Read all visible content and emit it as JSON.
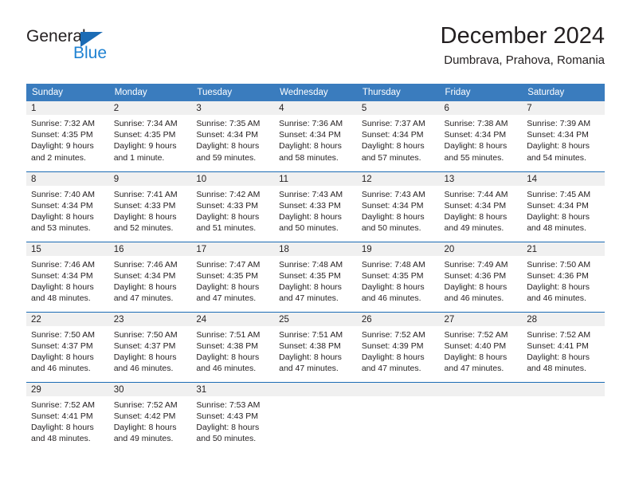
{
  "brand": {
    "name_top": "General",
    "name_bottom": "Blue",
    "accent_blue": "#1f82d2",
    "triangle_blue": "#1c6cb5"
  },
  "header": {
    "title": "December 2024",
    "subtitle": "Dumbrava, Prahova, Romania"
  },
  "calendar": {
    "header_bg": "#3a7cbe",
    "daynum_bg": "#f0f0f0",
    "row_divider": "#1c6cb5",
    "weekday_headers": [
      "Sunday",
      "Monday",
      "Tuesday",
      "Wednesday",
      "Thursday",
      "Friday",
      "Saturday"
    ],
    "weeks": [
      [
        {
          "day": "1",
          "sunrise": "Sunrise: 7:32 AM",
          "sunset": "Sunset: 4:35 PM",
          "daylight_1": "Daylight: 9 hours",
          "daylight_2": "and 2 minutes."
        },
        {
          "day": "2",
          "sunrise": "Sunrise: 7:34 AM",
          "sunset": "Sunset: 4:35 PM",
          "daylight_1": "Daylight: 9 hours",
          "daylight_2": "and 1 minute."
        },
        {
          "day": "3",
          "sunrise": "Sunrise: 7:35 AM",
          "sunset": "Sunset: 4:34 PM",
          "daylight_1": "Daylight: 8 hours",
          "daylight_2": "and 59 minutes."
        },
        {
          "day": "4",
          "sunrise": "Sunrise: 7:36 AM",
          "sunset": "Sunset: 4:34 PM",
          "daylight_1": "Daylight: 8 hours",
          "daylight_2": "and 58 minutes."
        },
        {
          "day": "5",
          "sunrise": "Sunrise: 7:37 AM",
          "sunset": "Sunset: 4:34 PM",
          "daylight_1": "Daylight: 8 hours",
          "daylight_2": "and 57 minutes."
        },
        {
          "day": "6",
          "sunrise": "Sunrise: 7:38 AM",
          "sunset": "Sunset: 4:34 PM",
          "daylight_1": "Daylight: 8 hours",
          "daylight_2": "and 55 minutes."
        },
        {
          "day": "7",
          "sunrise": "Sunrise: 7:39 AM",
          "sunset": "Sunset: 4:34 PM",
          "daylight_1": "Daylight: 8 hours",
          "daylight_2": "and 54 minutes."
        }
      ],
      [
        {
          "day": "8",
          "sunrise": "Sunrise: 7:40 AM",
          "sunset": "Sunset: 4:34 PM",
          "daylight_1": "Daylight: 8 hours",
          "daylight_2": "and 53 minutes."
        },
        {
          "day": "9",
          "sunrise": "Sunrise: 7:41 AM",
          "sunset": "Sunset: 4:33 PM",
          "daylight_1": "Daylight: 8 hours",
          "daylight_2": "and 52 minutes."
        },
        {
          "day": "10",
          "sunrise": "Sunrise: 7:42 AM",
          "sunset": "Sunset: 4:33 PM",
          "daylight_1": "Daylight: 8 hours",
          "daylight_2": "and 51 minutes."
        },
        {
          "day": "11",
          "sunrise": "Sunrise: 7:43 AM",
          "sunset": "Sunset: 4:33 PM",
          "daylight_1": "Daylight: 8 hours",
          "daylight_2": "and 50 minutes."
        },
        {
          "day": "12",
          "sunrise": "Sunrise: 7:43 AM",
          "sunset": "Sunset: 4:34 PM",
          "daylight_1": "Daylight: 8 hours",
          "daylight_2": "and 50 minutes."
        },
        {
          "day": "13",
          "sunrise": "Sunrise: 7:44 AM",
          "sunset": "Sunset: 4:34 PM",
          "daylight_1": "Daylight: 8 hours",
          "daylight_2": "and 49 minutes."
        },
        {
          "day": "14",
          "sunrise": "Sunrise: 7:45 AM",
          "sunset": "Sunset: 4:34 PM",
          "daylight_1": "Daylight: 8 hours",
          "daylight_2": "and 48 minutes."
        }
      ],
      [
        {
          "day": "15",
          "sunrise": "Sunrise: 7:46 AM",
          "sunset": "Sunset: 4:34 PM",
          "daylight_1": "Daylight: 8 hours",
          "daylight_2": "and 48 minutes."
        },
        {
          "day": "16",
          "sunrise": "Sunrise: 7:46 AM",
          "sunset": "Sunset: 4:34 PM",
          "daylight_1": "Daylight: 8 hours",
          "daylight_2": "and 47 minutes."
        },
        {
          "day": "17",
          "sunrise": "Sunrise: 7:47 AM",
          "sunset": "Sunset: 4:35 PM",
          "daylight_1": "Daylight: 8 hours",
          "daylight_2": "and 47 minutes."
        },
        {
          "day": "18",
          "sunrise": "Sunrise: 7:48 AM",
          "sunset": "Sunset: 4:35 PM",
          "daylight_1": "Daylight: 8 hours",
          "daylight_2": "and 47 minutes."
        },
        {
          "day": "19",
          "sunrise": "Sunrise: 7:48 AM",
          "sunset": "Sunset: 4:35 PM",
          "daylight_1": "Daylight: 8 hours",
          "daylight_2": "and 46 minutes."
        },
        {
          "day": "20",
          "sunrise": "Sunrise: 7:49 AM",
          "sunset": "Sunset: 4:36 PM",
          "daylight_1": "Daylight: 8 hours",
          "daylight_2": "and 46 minutes."
        },
        {
          "day": "21",
          "sunrise": "Sunrise: 7:50 AM",
          "sunset": "Sunset: 4:36 PM",
          "daylight_1": "Daylight: 8 hours",
          "daylight_2": "and 46 minutes."
        }
      ],
      [
        {
          "day": "22",
          "sunrise": "Sunrise: 7:50 AM",
          "sunset": "Sunset: 4:37 PM",
          "daylight_1": "Daylight: 8 hours",
          "daylight_2": "and 46 minutes."
        },
        {
          "day": "23",
          "sunrise": "Sunrise: 7:50 AM",
          "sunset": "Sunset: 4:37 PM",
          "daylight_1": "Daylight: 8 hours",
          "daylight_2": "and 46 minutes."
        },
        {
          "day": "24",
          "sunrise": "Sunrise: 7:51 AM",
          "sunset": "Sunset: 4:38 PM",
          "daylight_1": "Daylight: 8 hours",
          "daylight_2": "and 46 minutes."
        },
        {
          "day": "25",
          "sunrise": "Sunrise: 7:51 AM",
          "sunset": "Sunset: 4:38 PM",
          "daylight_1": "Daylight: 8 hours",
          "daylight_2": "and 47 minutes."
        },
        {
          "day": "26",
          "sunrise": "Sunrise: 7:52 AM",
          "sunset": "Sunset: 4:39 PM",
          "daylight_1": "Daylight: 8 hours",
          "daylight_2": "and 47 minutes."
        },
        {
          "day": "27",
          "sunrise": "Sunrise: 7:52 AM",
          "sunset": "Sunset: 4:40 PM",
          "daylight_1": "Daylight: 8 hours",
          "daylight_2": "and 47 minutes."
        },
        {
          "day": "28",
          "sunrise": "Sunrise: 7:52 AM",
          "sunset": "Sunset: 4:41 PM",
          "daylight_1": "Daylight: 8 hours",
          "daylight_2": "and 48 minutes."
        }
      ],
      [
        {
          "day": "29",
          "sunrise": "Sunrise: 7:52 AM",
          "sunset": "Sunset: 4:41 PM",
          "daylight_1": "Daylight: 8 hours",
          "daylight_2": "and 48 minutes."
        },
        {
          "day": "30",
          "sunrise": "Sunrise: 7:52 AM",
          "sunset": "Sunset: 4:42 PM",
          "daylight_1": "Daylight: 8 hours",
          "daylight_2": "and 49 minutes."
        },
        {
          "day": "31",
          "sunrise": "Sunrise: 7:53 AM",
          "sunset": "Sunset: 4:43 PM",
          "daylight_1": "Daylight: 8 hours",
          "daylight_2": "and 50 minutes."
        },
        {
          "day": "",
          "sunrise": "",
          "sunset": "",
          "daylight_1": "",
          "daylight_2": ""
        },
        {
          "day": "",
          "sunrise": "",
          "sunset": "",
          "daylight_1": "",
          "daylight_2": ""
        },
        {
          "day": "",
          "sunrise": "",
          "sunset": "",
          "daylight_1": "",
          "daylight_2": ""
        },
        {
          "day": "",
          "sunrise": "",
          "sunset": "",
          "daylight_1": "",
          "daylight_2": ""
        }
      ]
    ]
  }
}
